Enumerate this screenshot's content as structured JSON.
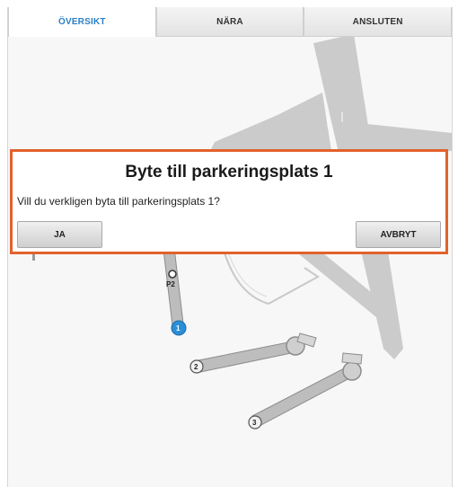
{
  "tabs": [
    {
      "label": "ÖVERSIKT",
      "active": true
    },
    {
      "label": "NÄRA",
      "active": false
    },
    {
      "label": "ANSLUTEN",
      "active": false
    }
  ],
  "map": {
    "stands": [
      {
        "label": "1",
        "selected": true
      },
      {
        "label": "2",
        "selected": false
      },
      {
        "label": "3",
        "selected": false
      }
    ],
    "marker_label": "P2",
    "colors": {
      "aircraft": "#cbcbcb",
      "bridge": "#bdbdbd",
      "selected_stand": "#2b8fd6"
    }
  },
  "dialog": {
    "title": "Byte till parkeringsplats 1",
    "message": "Vill du verkligen byta till parkeringsplats 1?",
    "confirm_label": "JA",
    "cancel_label": "AVBRYT",
    "border_color": "#e2622b"
  }
}
